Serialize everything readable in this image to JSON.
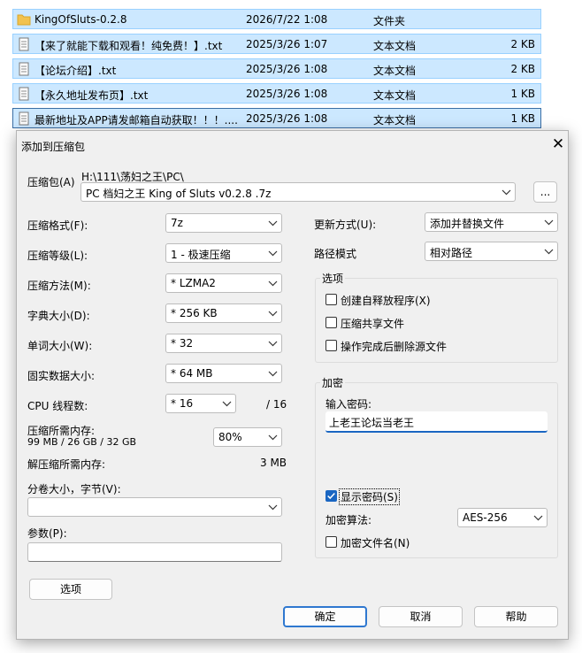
{
  "files": [
    {
      "name": "KingOfSluts-0.2.8",
      "date": "2026/7/22 1:08",
      "type": "文件夹",
      "size": "",
      "icon": "folder-icon"
    },
    {
      "name": "【来了就能下载和观看！纯免费！】.txt",
      "date": "2025/3/26 1:07",
      "type": "文本文档",
      "size": "2 KB",
      "icon": "text-file-icon"
    },
    {
      "name": "【论坛介绍】.txt",
      "date": "2025/3/26 1:08",
      "type": "文本文档",
      "size": "2 KB",
      "icon": "text-file-icon"
    },
    {
      "name": "【永久地址发布页】.txt",
      "date": "2025/3/26 1:08",
      "type": "文本文档",
      "size": "1 KB",
      "icon": "text-file-icon"
    },
    {
      "name": "最新地址及APP请发邮箱自动获取！！！....",
      "date": "2025/3/26 1:08",
      "type": "文本文档",
      "size": "1 KB",
      "icon": "text-file-icon"
    }
  ],
  "dialog": {
    "title": "添加到压缩包",
    "close": "✕",
    "archive_label": "压缩包(A)",
    "archive_path": "H:\\111\\荡妇之王\\PC\\",
    "archive_name": "PC 档妇之王 King of Sluts  v0.2.8 .7z",
    "browse": "...",
    "format_label": "压缩格式(F):",
    "format": "7z",
    "level_label": "压缩等级(L):",
    "level": "1 - 极速压缩",
    "method_label": "压缩方法(M):",
    "method": "*  LZMA2",
    "dict_label": "字典大小(D):",
    "dict": "*  256 KB",
    "word_label": "单词大小(W):",
    "word": "*  32",
    "solid_label": "固实数据大小:",
    "solid": "*  64 MB",
    "cpu_label": "CPU 线程数:",
    "cpu": "*  16",
    "cpu_total": "/ 16",
    "mem_label": "压缩所需内存:",
    "mem_value": "99 MB / 26 GB / 32 GB",
    "mem_pct": "80%",
    "decomp_label": "解压缩所需内存:",
    "decomp_value": "3 MB",
    "split_label": "分卷大小，字节(V):",
    "split": "",
    "params_label": "参数(P):",
    "params": "",
    "options_btn": "选项",
    "update_label": "更新方式(U):",
    "update": "添加并替换文件",
    "path_label": "路径模式",
    "path_mode": "相对路径",
    "opts_group": "选项",
    "opt_sfx": "创建自释放程序(X)",
    "opt_sfx_checked": false,
    "opt_shared": "压缩共享文件",
    "opt_shared_checked": false,
    "opt_delete": "操作完成后删除源文件",
    "opt_delete_checked": false,
    "enc_group": "加密",
    "pw_label": "输入密码:",
    "password": "上老王论坛当老王",
    "show_pw": "显示密码(S)",
    "show_pw_checked": true,
    "enc_method_label": "加密算法:",
    "enc_method": "AES-256",
    "enc_names": "加密文件名(N)",
    "enc_names_checked": false,
    "ok": "确定",
    "cancel": "取消",
    "help": "帮助"
  }
}
